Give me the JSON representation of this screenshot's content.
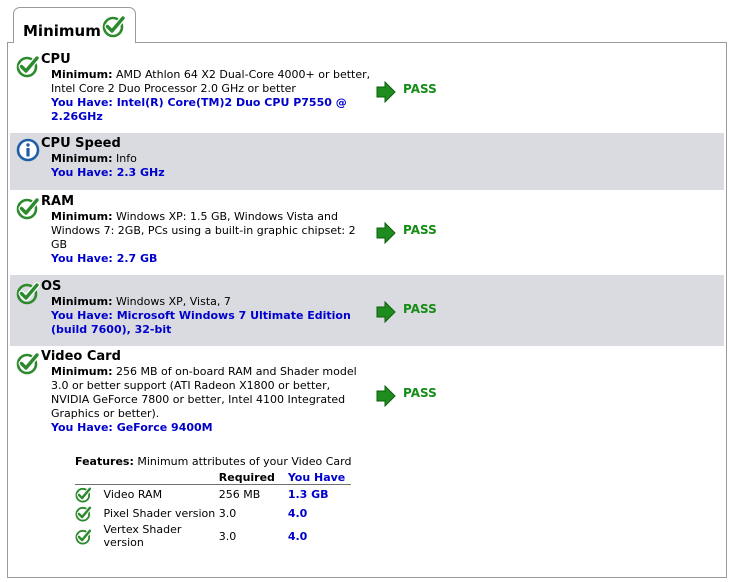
{
  "tab": {
    "label": "Minimum"
  },
  "sections": [
    {
      "title": "CPU",
      "min_label": "Minimum:",
      "minimum": "AMD Athlon 64 X2 Dual-Core 4000+ or better, Intel Core 2 Duo Processor 2.0 GHz or better",
      "have_label": "You Have:",
      "you_have": "Intel(R) Core(TM)2 Duo CPU P7550 @ 2.26GHz",
      "status": "PASS",
      "icon": "check-icon"
    },
    {
      "title": "CPU Speed",
      "min_label": "Minimum:",
      "minimum": "Info",
      "have_label": "You Have:",
      "you_have": "2.3 GHz",
      "icon": "info-icon"
    },
    {
      "title": "RAM",
      "min_label": "Minimum:",
      "minimum": "Windows XP: 1.5 GB, Windows Vista and Windows 7: 2GB, PCs using a built-in graphic chipset: 2 GB",
      "have_label": "You Have:",
      "you_have": "2.7 GB",
      "status": "PASS",
      "icon": "check-icon"
    },
    {
      "title": "OS",
      "min_label": "Minimum:",
      "minimum": "Windows XP, Vista, 7",
      "have_label": "You Have:",
      "you_have": "Microsoft Windows 7 Ultimate Edition (build 7600), 32-bit",
      "status": "PASS",
      "icon": "check-icon"
    },
    {
      "title": "Video Card",
      "min_label": "Minimum:",
      "minimum": "256 MB of on-board RAM and Shader model 3.0 or better support (ATI Radeon X1800 or better, NVIDIA GeForce 7800 or better, Intel 4100 Integrated Graphics or better).",
      "have_label": "You Have:",
      "you_have": "GeForce 9400M",
      "status": "PASS",
      "icon": "check-icon"
    }
  ],
  "features": {
    "label": "Features:",
    "description": "Minimum attributes of your Video Card",
    "col_required": "Required",
    "col_you_have": "You Have",
    "rows": [
      {
        "name": "Video RAM",
        "required": "256 MB",
        "you_have": "1.3 GB"
      },
      {
        "name": "Pixel Shader version",
        "required": "3.0",
        "you_have": "4.0"
      },
      {
        "name": "Vertex Shader version",
        "required": "3.0",
        "you_have": "4.0"
      }
    ]
  },
  "colors": {
    "pass_green": "#158c15",
    "have_blue": "#0000cc",
    "shaded_row": "#d9dbe0",
    "info_blue": "#1f5fa8"
  }
}
